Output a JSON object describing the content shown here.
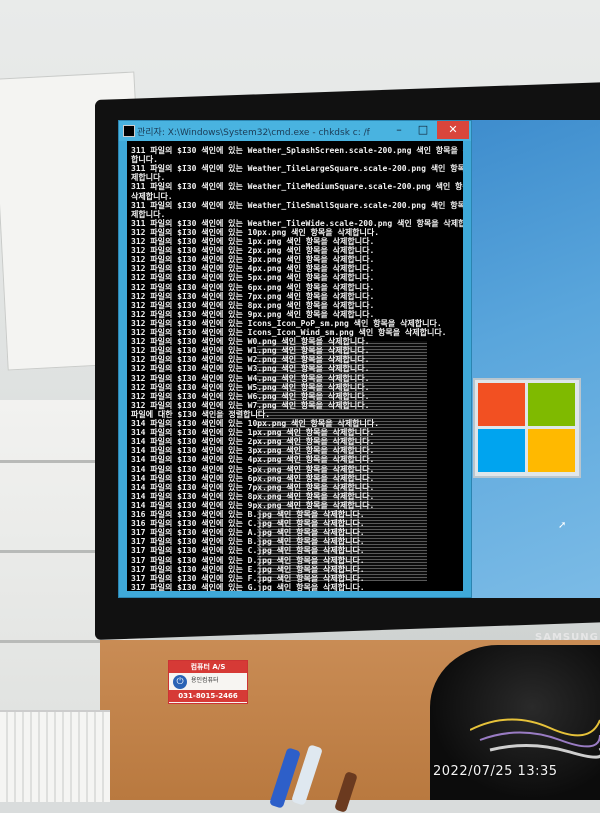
{
  "photo": {
    "timestamp": "2022/07/25  13:35"
  },
  "monitor": {
    "brand": "SAMSUNG"
  },
  "cmd_window": {
    "title": "관리자: X:\\Windows\\System32\\cmd.exe - chkdsk c: /f",
    "buttons": {
      "minimize": "–",
      "maximize": "□",
      "close": "✕"
    },
    "console_lines": [
      "311 파일의 $I30 색인에 있는 Weather_SplashScreen.scale-200.png 색인 항목을 삭",
      "합니다.",
      "311 파일의 $I30 색인에 있는 Weather_TileLargeSquare.scale-200.png 색인 항목을 삭",
      "제합니다.",
      "311 파일의 $I30 색인에 있는 Weather_TileMediumSquare.scale-200.png 색인 항목을",
      "삭제합니다.",
      "311 파일의 $I30 색인에 있는 Weather_TileSmallSquare.scale-200.png 색인 항목을",
      "제합니다.",
      "311 파일의 $I30 색인에 있는 Weather_TileWide.scale-200.png 색인 항목을 삭제합니",
      "312 파일의 $I30 색인에 있는 10px.png 색인 항목을 삭제합니다.",
      "312 파일의 $I30 색인에 있는 1px.png 색인 항목을 삭제합니다.",
      "312 파일의 $I30 색인에 있는 2px.png 색인 항목을 삭제합니다.",
      "312 파일의 $I30 색인에 있는 3px.png 색인 항목을 삭제합니다.",
      "312 파일의 $I30 색인에 있는 4px.png 색인 항목을 삭제합니다.",
      "312 파일의 $I30 색인에 있는 5px.png 색인 항목을 삭제합니다.",
      "312 파일의 $I30 색인에 있는 6px.png 색인 항목을 삭제합니다.",
      "312 파일의 $I30 색인에 있는 7px.png 색인 항목을 삭제합니다.",
      "312 파일의 $I30 색인에 있는 8px.png 색인 항목을 삭제합니다.",
      "312 파일의 $I30 색인에 있는 9px.png 색인 항목을 삭제합니다.",
      "312 파일의 $I30 색인에 있는 Icons_Icon_PoP_sm.png 색인 항목을 삭제합니다.",
      "312 파일의 $I30 색인에 있는 Icons_Icon_Wind_sm.png 색인 항목을 삭제합니다.",
      "312 파일의 $I30 색인에 있는 W0.png 색인 항목을 삭제합니다.",
      "312 파일의 $I30 색인에 있는 W1.png 색인 항목을 삭제합니다.",
      "312 파일의 $I30 색인에 있는 W2.png 색인 항목을 삭제합니다.",
      "312 파일의 $I30 색인에 있는 W3.png 색인 항목을 삭제합니다.",
      "312 파일의 $I30 색인에 있는 W4.png 색인 항목을 삭제합니다.",
      "312 파일의 $I30 색인에 있는 W5.png 색인 항목을 삭제합니다.",
      "312 파일의 $I30 색인에 있는 W6.png 색인 항목을 삭제합니다.",
      "312 파일의 $I30 색인에 있는 W7.png 색인 항목을 삭제합니다.",
      "파일에 대한 $I30 색인을 정렬합니다.",
      "314 파일의 $I30 색인에 있는 10px.png 색인 항목을 삭제합니다.",
      "314 파일의 $I30 색인에 있는 1px.png 색인 항목을 삭제합니다.",
      "314 파일의 $I30 색인에 있는 2px.png 색인 항목을 삭제합니다.",
      "314 파일의 $I30 색인에 있는 3px.png 색인 항목을 삭제합니다.",
      "314 파일의 $I30 색인에 있는 4px.png 색인 항목을 삭제합니다.",
      "314 파일의 $I30 색인에 있는 5px.png 색인 항목을 삭제합니다.",
      "314 파일의 $I30 색인에 있는 6px.png 색인 항목을 삭제합니다.",
      "314 파일의 $I30 색인에 있는 7px.png 색인 항목을 삭제합니다.",
      "314 파일의 $I30 색인에 있는 8px.png 색인 항목을 삭제합니다.",
      "314 파일의 $I30 색인에 있는 9px.png 색인 항목을 삭제합니다.",
      "316 파일의 $I30 색인에 있는 B.jpg 색인 항목을 삭제합니다.",
      "316 파일의 $I30 색인에 있는 C.jpg 색인 항목을 삭제합니다.",
      "317 파일의 $I30 색인에 있는 A.jpg 색인 항목을 삭제합니다.",
      "317 파일의 $I30 색인에 있는 B.jpg 색인 항목을 삭제합니다.",
      "317 파일의 $I30 색인에 있는 C.jpg 색인 항목을 삭제합니다.",
      "317 파일의 $I30 색인에 있는 D.jpg 색인 항목을 삭제합니다.",
      "317 파일의 $I30 색인에 있는 E.jpg 색인 항목을 삭제합니다.",
      "317 파일의 $I30 색인에 있는 F.jpg 색인 항목을 삭제합니다.",
      "317 파일의 $I30 색인에 있는 G.jpg 색인 항목을 삭제합니다."
    ]
  },
  "windows_logo": {
    "colors": [
      "#f25022",
      "#7fba00",
      "#00a4ef",
      "#ffb900"
    ]
  },
  "taskbar": {
    "icons": [
      "presentation-icon",
      "folder-icon",
      "media-icon",
      "cmd-icon"
    ]
  },
  "sticker": {
    "header": "컴퓨터 A/S",
    "shop": "용인컴퓨터",
    "phone": "031-8015-2466"
  }
}
